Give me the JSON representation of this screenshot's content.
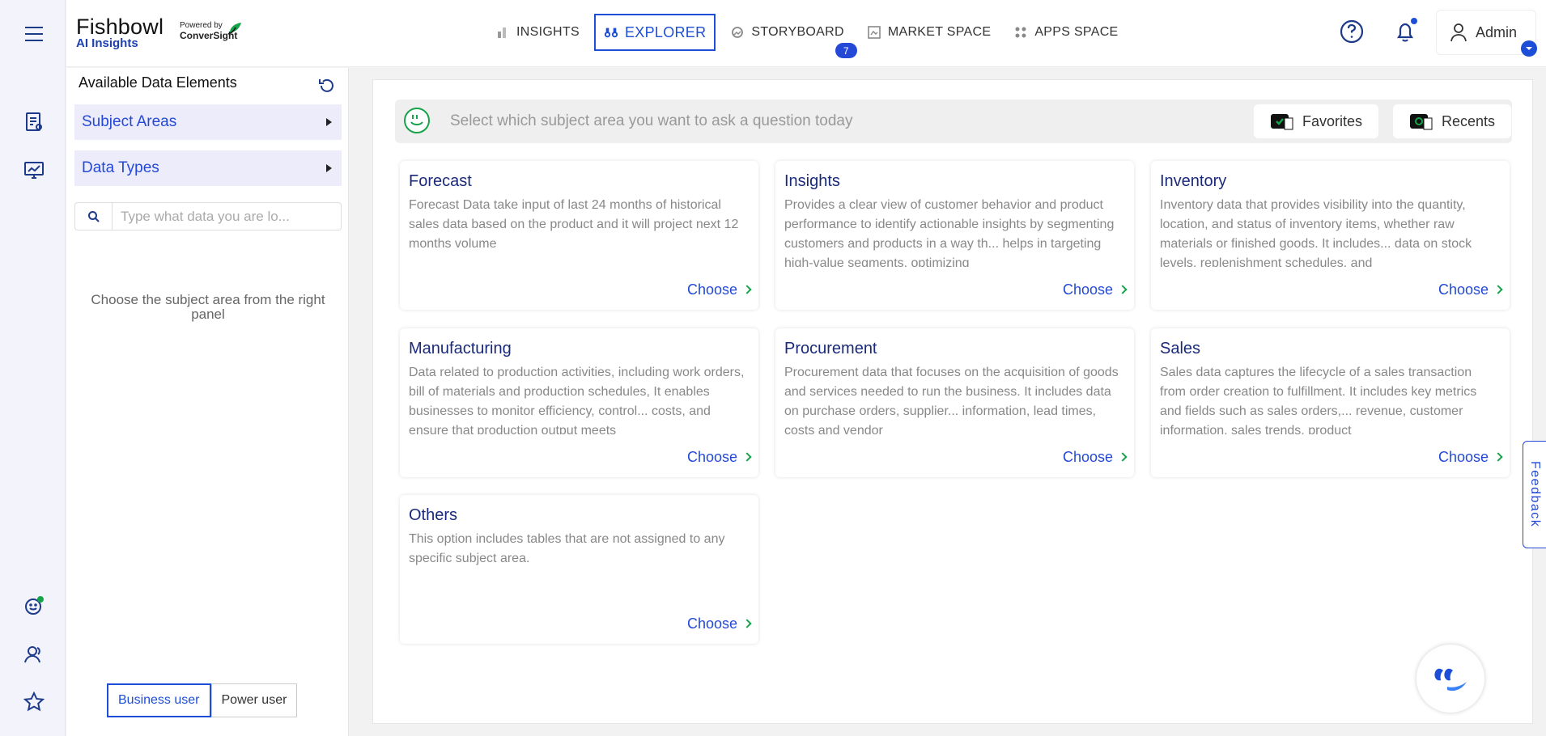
{
  "rail": {
    "icons": [
      "menu-icon",
      "report-icon",
      "dashboard-icon",
      "assistant-icon",
      "users-icon",
      "star-icon"
    ]
  },
  "brand": {
    "name": "Fishbowl",
    "sub": "AI Insights",
    "powered_by": "Powered by",
    "partner": "ConverSight"
  },
  "nav": {
    "items": [
      {
        "label": "INSIGHTS",
        "icon": "bar-chart-icon"
      },
      {
        "label": "EXPLORER",
        "icon": "binoculars-icon"
      },
      {
        "label": "STORYBOARD",
        "icon": "storyboard-icon",
        "badge": "7"
      },
      {
        "label": "MARKET SPACE",
        "icon": "market-icon"
      },
      {
        "label": "APPS SPACE",
        "icon": "apps-icon"
      }
    ],
    "active": "EXPLORER"
  },
  "header": {
    "user": "Admin"
  },
  "panel": {
    "title": "Available Data Elements",
    "accordions": [
      "Subject Areas",
      "Data Types"
    ],
    "search_placeholder": "Type what data you are lo...",
    "empty_message": "Choose the subject area from the right panel",
    "modes": [
      "Business user",
      "Power user"
    ],
    "active_mode": "Business user"
  },
  "main": {
    "prompt": "Select which subject area you want to ask a question today",
    "favorites": "Favorites",
    "recents": "Recents",
    "choose_label": "Choose",
    "cards": [
      {
        "title": "Forecast",
        "desc": "Forecast Data take input of last 24 months of historical sales data based on the product and it will project next 12 months volume"
      },
      {
        "title": "Insights",
        "desc": "Provides a clear view of customer behavior and product performance to identify actionable insights by segmenting customers and products in a way th... helps in targeting high-value segments, optimizing"
      },
      {
        "title": "Inventory",
        "desc": "Inventory data that provides visibility into the quantity, location, and status of inventory items, whether raw materials or finished goods. It includes... data on stock levels, replenishment schedules, and"
      },
      {
        "title": "Manufacturing",
        "desc": "Data related to production activities, including work orders, bill of materials and production schedules, It enables businesses to monitor efficiency, control... costs, and ensure that production output meets"
      },
      {
        "title": "Procurement",
        "desc": "Procurement data that focuses on the acquisition of goods and services needed to run the business. It includes data on purchase orders, supplier... information, lead times, costs and vendor"
      },
      {
        "title": "Sales",
        "desc": "Sales data captures the lifecycle of a sales transaction from order creation to fulfillment. It includes key metrics and fields such as sales orders,... revenue, customer information, sales trends, product"
      },
      {
        "title": "Others",
        "desc": "This option includes tables that are not assigned to any specific subject area."
      }
    ]
  },
  "feedback": "Feedback",
  "colors": {
    "accent": "#2449d6",
    "title": "#1a2a7a",
    "rail_bg": "#f3f3fb",
    "green": "#16a34a"
  }
}
